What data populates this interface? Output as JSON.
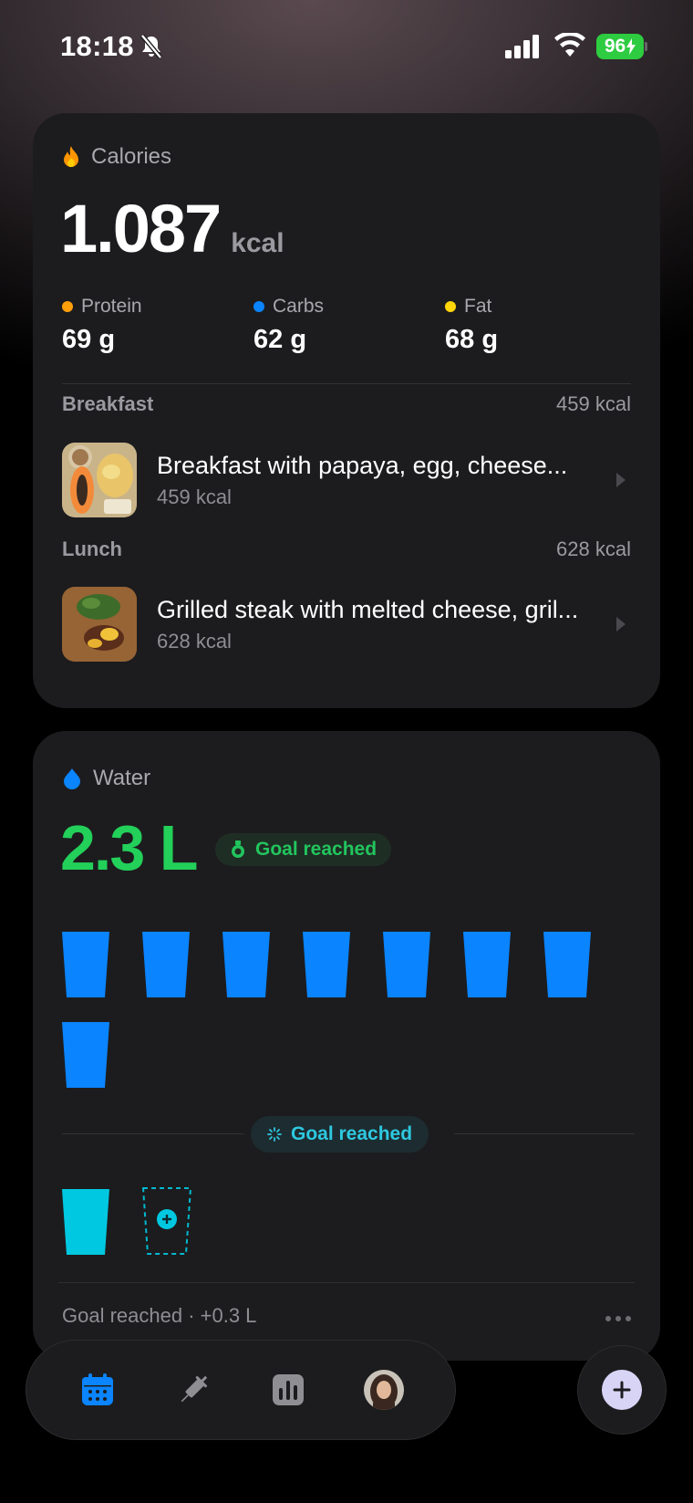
{
  "status_bar": {
    "time": "18:18",
    "battery": "96",
    "icons": [
      "bell-slash-icon",
      "cellular-signal-icon",
      "wifi-icon",
      "battery-charging-icon"
    ]
  },
  "calories": {
    "title": "Calories",
    "icon": "flame-icon",
    "total": "1.087",
    "unit": "kcal",
    "macros": [
      {
        "label": "Protein",
        "value": "69 g",
        "color": "#ff9f0a"
      },
      {
        "label": "Carbs",
        "value": "62 g",
        "color": "#0a84ff"
      },
      {
        "label": "Fat",
        "value": "68 g",
        "color": "#ffd60a"
      }
    ],
    "meals": [
      {
        "name": "Breakfast",
        "kcal": "459 kcal",
        "item_title": "Breakfast with papaya, egg, cheese...",
        "item_kcal": "459 kcal"
      },
      {
        "name": "Lunch",
        "kcal": "628 kcal",
        "item_title": "Grilled steak with melted cheese, gril...",
        "item_kcal": "628 kcal"
      }
    ]
  },
  "water": {
    "title": "Water",
    "icon": "water-drop-icon",
    "amount": "2.3 L",
    "goal_badge": "Goal reached",
    "goal_divider_label": "Goal reached",
    "cups_filled": 8,
    "extra_cups_filled": 1,
    "footer": "Goal reached · +0.3 L",
    "colors": {
      "amount": "#22d05a",
      "cup": "#0a84ff",
      "extra_cup": "#00c8e0"
    }
  },
  "tab_bar": {
    "tabs": [
      "calendar-icon",
      "syringe-icon",
      "stats-chart-icon",
      "profile-avatar"
    ],
    "fab": "plus-icon"
  }
}
